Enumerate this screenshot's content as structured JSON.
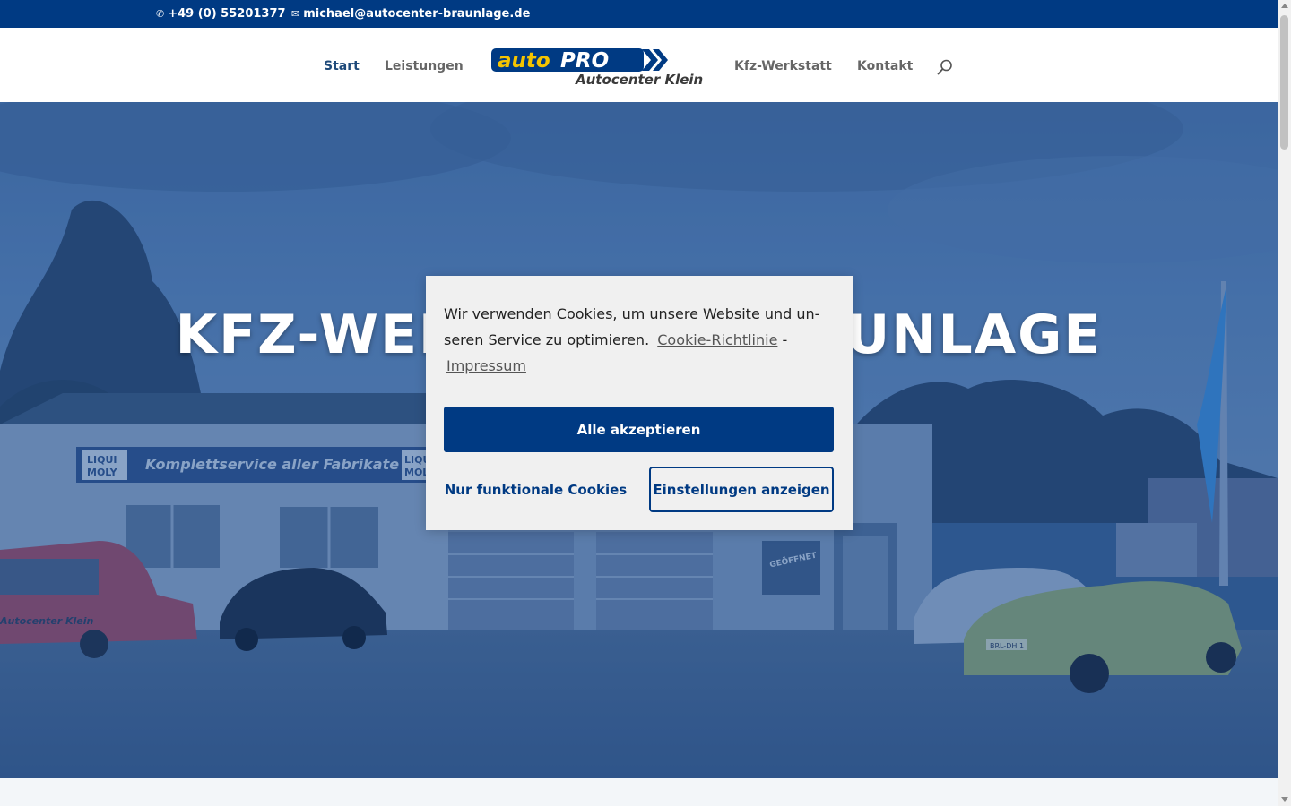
{
  "topbar": {
    "phone": "+49 (0) 55201377",
    "email": "michael@autocenter-braunlage.de"
  },
  "nav": {
    "items": [
      {
        "label": "Start"
      },
      {
        "label": "Leistungen"
      },
      {
        "label": "Kfz-Werkstatt"
      },
      {
        "label": "Kontakt"
      }
    ],
    "active": "Start"
  },
  "logo": {
    "brand": "AUTOPRO",
    "subtitle": "Autocenter Klein"
  },
  "hero": {
    "title": "KFZ-WERKSTATT BRAUNLAGE",
    "sign_left": "LIQUI MOLY",
    "sign_banner": "Komplettservice aller Fabrikate",
    "sign_right": "LIQUI MOLY",
    "door_sign": "GEÖFFNET",
    "van_text": "Autocenter Klein",
    "plate_yellow_car": "BRL-DH 1"
  },
  "cookie": {
    "message": "Wir verwenden Cookies, um unsere Website und un-seren Service zu optimieren.",
    "link_policy": "Cookie-Richtlinie",
    "separator": "-",
    "link_imprint": "Impressum",
    "btn_accept": "Alle akzeptieren",
    "btn_functional": "Nur funktionale Cookies",
    "btn_settings": "Einstellungen anzeigen"
  },
  "colors": {
    "brand_blue": "#003a83",
    "logo_yellow": "#f5c400"
  }
}
